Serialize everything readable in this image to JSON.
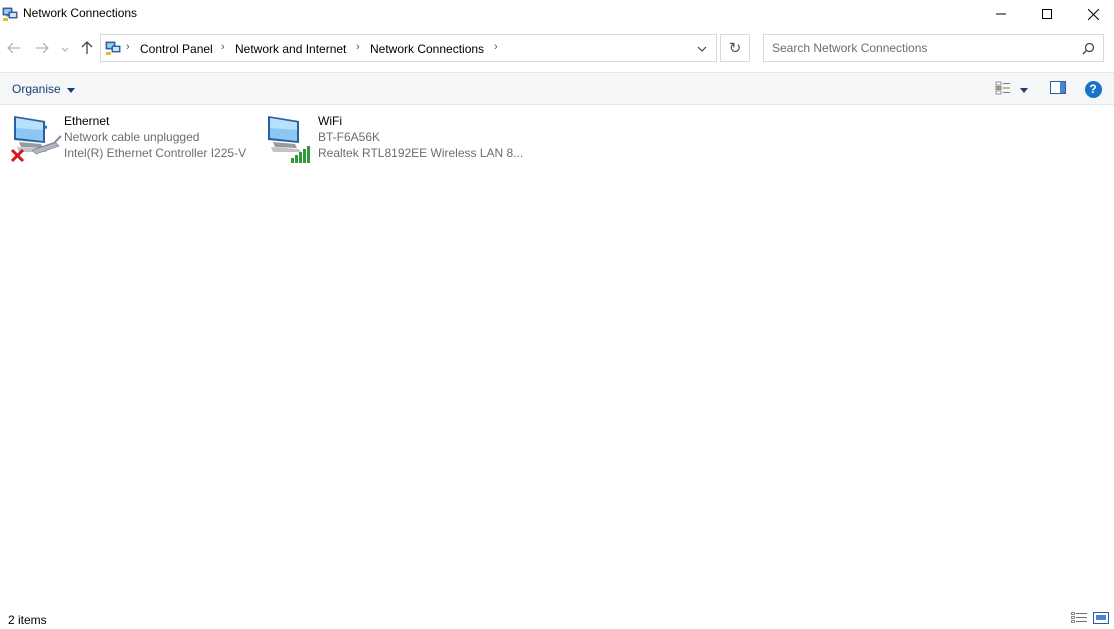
{
  "window": {
    "title": "Network Connections",
    "icons": {
      "app": "network-connections-icon",
      "minimize": "minimize-icon",
      "maximize": "maximize-icon",
      "close": "close-icon"
    }
  },
  "navigation": {
    "icons": {
      "back": "back-arrow-icon",
      "forward": "forward-arrow-icon",
      "recent": "chevron-down-icon",
      "up": "up-arrow-icon"
    }
  },
  "address": {
    "breadcrumbs": [
      "Control Panel",
      "Network and Internet",
      "Network Connections"
    ],
    "icons": {
      "location": "control-panel-icon",
      "dropdown": "chevron-down-icon",
      "refresh": "refresh-icon"
    },
    "refresh_glyph": "↻"
  },
  "search": {
    "placeholder": "Search Network Connections",
    "value": "",
    "icon": "search-icon"
  },
  "toolbar": {
    "organise_label": "Organise",
    "icons": {
      "change_view": "change-view-icon",
      "more_options": "chevron-down-icon",
      "preview_pane": "preview-pane-icon",
      "help": "help-icon"
    },
    "help_glyph": "?"
  },
  "connections": [
    {
      "name": "Ethernet",
      "status": "Network cable unplugged",
      "device": "Intel(R) Ethernet Controller I225-V",
      "icon": "ethernet-disconnected-icon"
    },
    {
      "name": "WiFi",
      "status": "BT-F6A56K",
      "device": "Realtek RTL8192EE Wireless LAN 8...",
      "icon": "wifi-connected-icon"
    }
  ],
  "status": {
    "item_count": "2 items",
    "icons": {
      "details_view": "details-view-icon",
      "large_icons_view": "large-icons-view-icon"
    }
  },
  "colors": {
    "link_blue": "#1a3c78",
    "help_blue": "#1a73c8",
    "error_red": "#d21a1a",
    "signal_green": "#2e9a3a",
    "muted_text": "#6d6d6d"
  }
}
